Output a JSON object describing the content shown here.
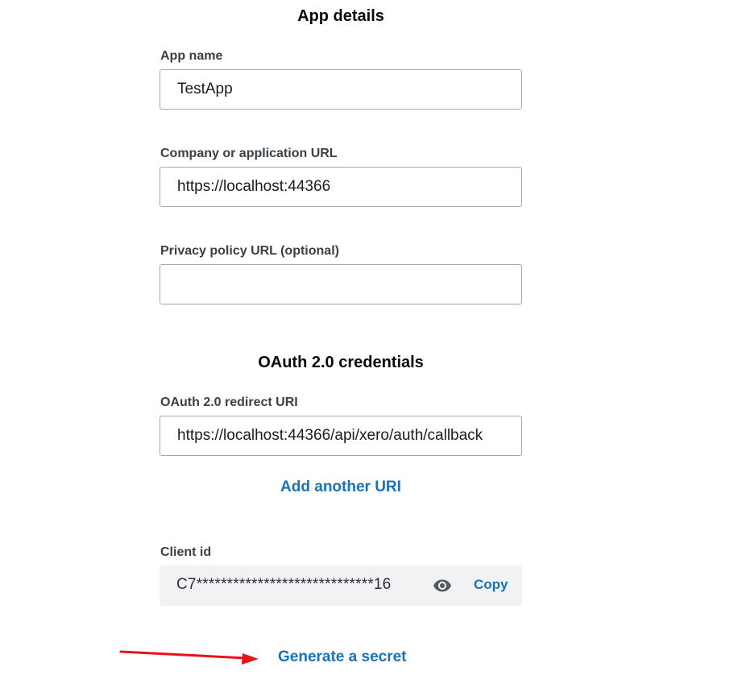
{
  "app_details": {
    "title": "App details",
    "app_name": {
      "label": "App name",
      "value": "TestApp"
    },
    "company_url": {
      "label": "Company or application URL",
      "value": "https://localhost:44366"
    },
    "privacy_url": {
      "label": "Privacy policy URL (optional)",
      "value": ""
    }
  },
  "oauth": {
    "title": "OAuth 2.0 credentials",
    "redirect_uri": {
      "label": "OAuth 2.0 redirect URI",
      "value": "https://localhost:44366/api/xero/auth/callback"
    },
    "add_uri_label": "Add another URI",
    "client_id": {
      "label": "Client id",
      "value": "C7*****************************16",
      "show_icon": "eye-icon",
      "copy_label": "Copy"
    },
    "generate_secret_label": "Generate a secret"
  },
  "annotation": {
    "arrow_color": "#e8121a"
  },
  "colors": {
    "link": "#1a73b8",
    "input_border": "#a3a7ad",
    "readonly_bg": "#f0f2f4"
  }
}
